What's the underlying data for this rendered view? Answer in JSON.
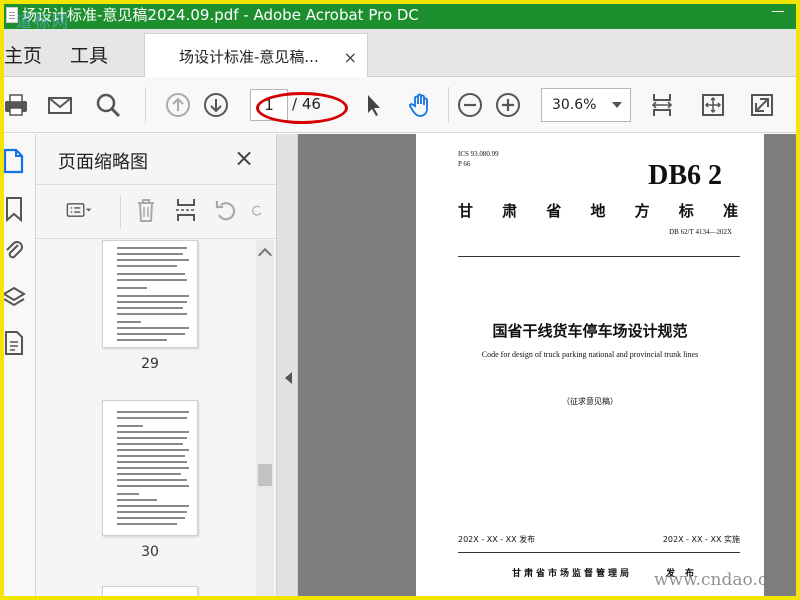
{
  "window": {
    "title": "场设计标准-意见稿2024.09.pdf - Adobe Acrobat Pro DC"
  },
  "watermarks": {
    "top_left": "道标网",
    "bottom_right": "www.cndao.c"
  },
  "menu": {
    "home": "主页",
    "tools": "工具"
  },
  "doc_tab": {
    "label": "场设计标准-意见稿...",
    "close": "×"
  },
  "toolbar": {
    "page_current": "1",
    "page_total": "/ 46",
    "zoom": "30.6%"
  },
  "thumbnail_panel": {
    "title": "页面缩略图",
    "close": "×",
    "thumbnails": [
      {
        "page_number": "29"
      },
      {
        "page_number": "30"
      }
    ]
  },
  "document_page": {
    "ics": "ICS 93.080.99",
    "p_code": "P 66",
    "db": "DB6 2",
    "province_chars": [
      "甘",
      "肃",
      "省",
      "地",
      "方",
      "标",
      "准"
    ],
    "std_no": "DB 62/T 4134—202X",
    "title_cn": "国省干线货车停车场设计规范",
    "title_en": "Code for design of truck parking national and provincial trunk lines",
    "draft": "（征求意见稿）",
    "issue_date": "202X - XX - XX 发布",
    "impl_date": "202X - XX - XX 实施",
    "publisher": "甘肃省市场监督管理局",
    "publish": "发布"
  },
  "colors": {
    "title_bar": "#1e8f2f",
    "frame": "#f2e600",
    "accent_blue": "#1473e6",
    "annotation_red": "#d40000"
  },
  "icons": [
    "print-icon",
    "mail-icon",
    "search-icon",
    "prev-page-icon",
    "next-page-icon",
    "select-arrow-icon",
    "hand-tool-icon",
    "zoom-out-icon",
    "zoom-in-icon",
    "fit-page-icon",
    "fit-width-icon",
    "fullscreen-icon"
  ]
}
